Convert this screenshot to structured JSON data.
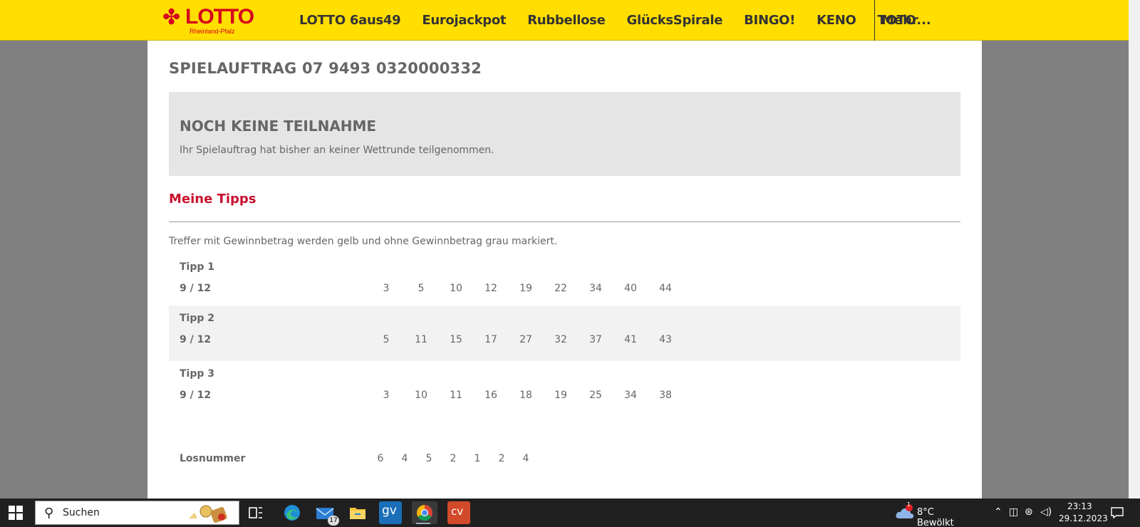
{
  "header": {
    "logo_text": "LOTTO",
    "logo_sub": "Rheinland-Pfalz",
    "nav": [
      "LOTTO 6aus49",
      "Eurojackpot",
      "Rubbellose",
      "GlücksSpirale",
      "BINGO!",
      "KENO",
      "TOTO"
    ],
    "more_label": "Mehr..."
  },
  "main": {
    "order_title": "SPIELAUFTRAG 07 9493 0320000332",
    "info_title": "NOCH KEINE TEILNAHME",
    "info_text": "Ihr Spielauftrag hat bisher an keiner Wettrunde teilgenommen.",
    "tips_heading": "Meine Tipps",
    "legend": "Treffer mit Gewinnbetrag werden gelb und ohne Gewinnbetrag grau markiert.",
    "tips": [
      {
        "label": "Tipp 1",
        "score": "9 / 12",
        "numbers": [
          "3",
          "5",
          "10",
          "12",
          "19",
          "22",
          "34",
          "40",
          "44"
        ]
      },
      {
        "label": "Tipp 2",
        "score": "9 / 12",
        "numbers": [
          "5",
          "11",
          "15",
          "17",
          "27",
          "32",
          "37",
          "41",
          "43"
        ]
      },
      {
        "label": "Tipp 3",
        "score": "9 / 12",
        "numbers": [
          "3",
          "10",
          "11",
          "16",
          "18",
          "19",
          "25",
          "34",
          "38"
        ]
      }
    ],
    "losnummer_label": "Losnummer",
    "losnummer_digits": [
      "6",
      "4",
      "5",
      "2",
      "1",
      "2",
      "4"
    ]
  },
  "taskbar": {
    "search_label": "Suchen",
    "mail_badge": "17",
    "gv_label": "gv",
    "cv_label": "cv",
    "weather": "8°C  Bewölkt",
    "weather_badge": "1",
    "time": "23:13",
    "date": "29.12.2023",
    "icons": [
      "windows-start-icon",
      "search-icon",
      "task-view-icon",
      "edge-icon",
      "mail-icon",
      "file-explorer-icon",
      "gv-app-icon",
      "chrome-icon",
      "cv-app-icon"
    ]
  },
  "colors": {
    "header_bg": "#ffde00",
    "brand_red": "#d6001c",
    "heading_red": "#c8102e",
    "info_bg": "#e5e5e5",
    "row_shade": "#f2f2f2"
  }
}
